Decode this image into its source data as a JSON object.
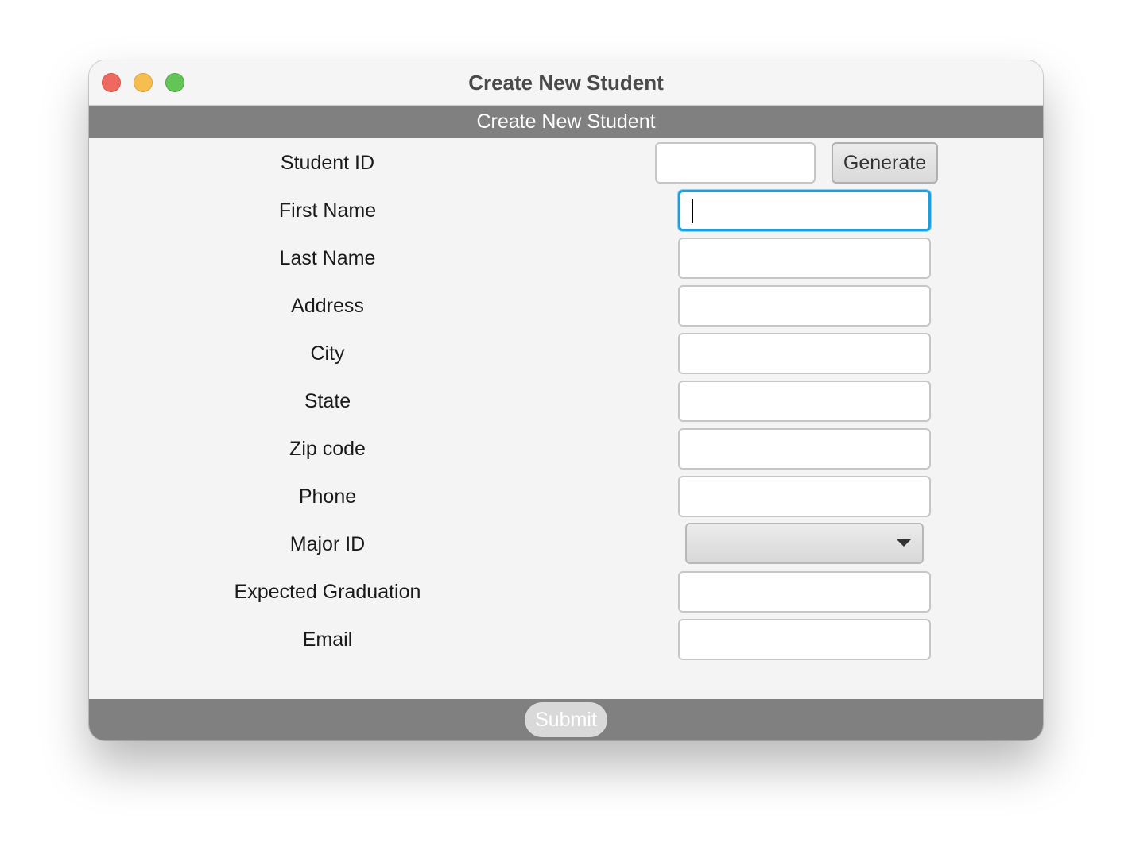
{
  "window": {
    "title": "Create New Student"
  },
  "form": {
    "heading": "Create New Student",
    "generate_label": "Generate",
    "submit_label": "Submit",
    "major_id_value": "",
    "fields": [
      {
        "label": "Student ID",
        "value": ""
      },
      {
        "label": "First Name",
        "value": ""
      },
      {
        "label": "Last Name",
        "value": ""
      },
      {
        "label": "Address",
        "value": ""
      },
      {
        "label": "City",
        "value": ""
      },
      {
        "label": "State",
        "value": ""
      },
      {
        "label": "Zip code",
        "value": ""
      },
      {
        "label": "Phone",
        "value": ""
      },
      {
        "label": "Major ID",
        "value": ""
      },
      {
        "label": "Expected Graduation",
        "value": ""
      },
      {
        "label": "Email",
        "value": ""
      }
    ]
  },
  "colors": {
    "header_band": "#808080",
    "focus_ring": "#1aa0e0",
    "close": "#ee6a5f",
    "minimize": "#f5be4f",
    "maximize": "#62c555"
  },
  "icons": {
    "combo_arrow": "chevron-down-icon"
  }
}
